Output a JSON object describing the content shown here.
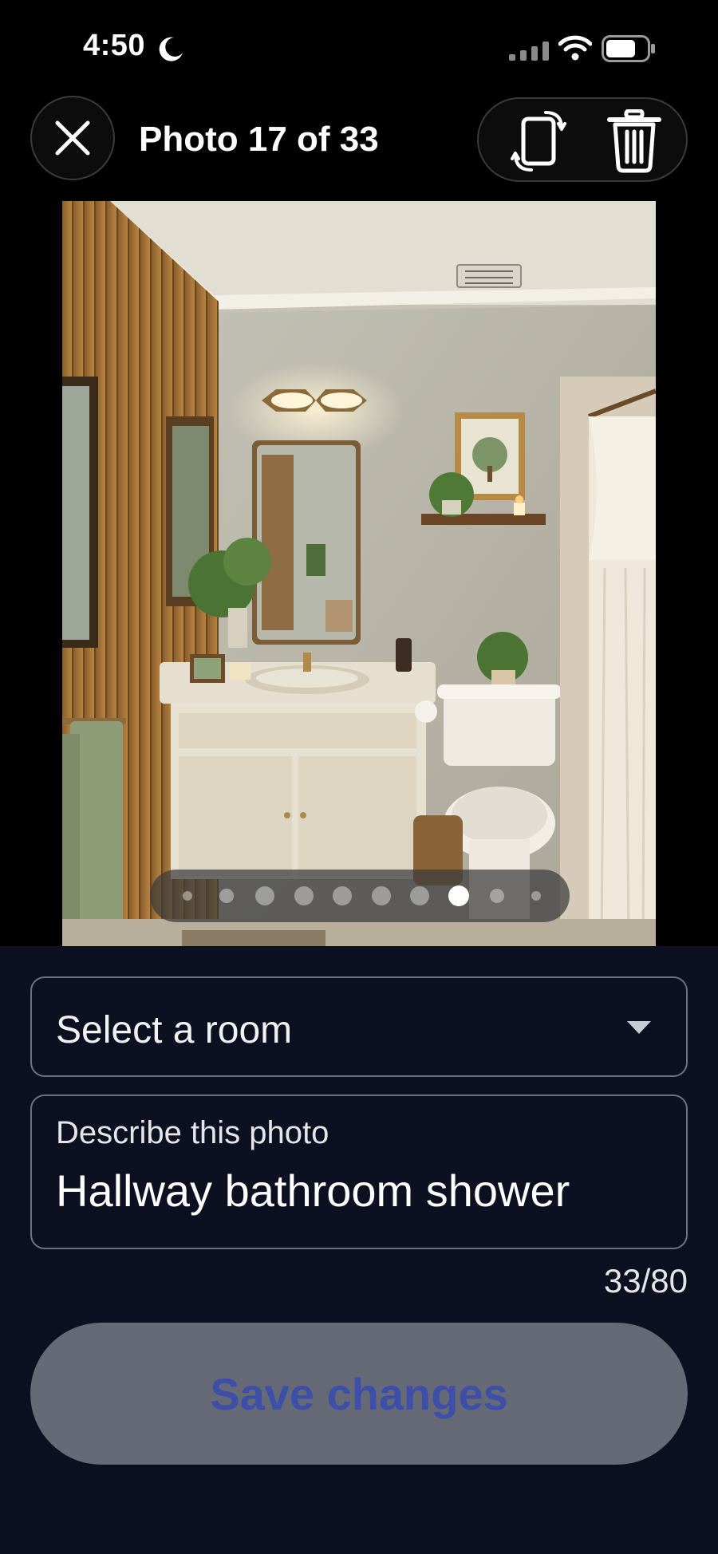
{
  "status_bar": {
    "time": "4:50",
    "icons": [
      "moon-icon",
      "signal-icon",
      "wifi-icon",
      "battery-icon"
    ]
  },
  "header": {
    "counter": "Photo 17 of 33",
    "close_icon": "close-icon",
    "rotate_icon": "rotate-icon",
    "delete_icon": "trash-icon"
  },
  "pager": {
    "dot_count": 10,
    "active_index": 7
  },
  "form": {
    "room_select_placeholder": "Select a room",
    "description_label": "Describe this photo",
    "description_value": "Hallway bathroom shower",
    "char_count": "33/80",
    "save_label": "Save changes"
  },
  "colors": {
    "sheet_background": "#0d1020",
    "field_border": "#6c7282",
    "save_button_bg": "#656a76",
    "save_button_text": "#3d4fa8"
  }
}
